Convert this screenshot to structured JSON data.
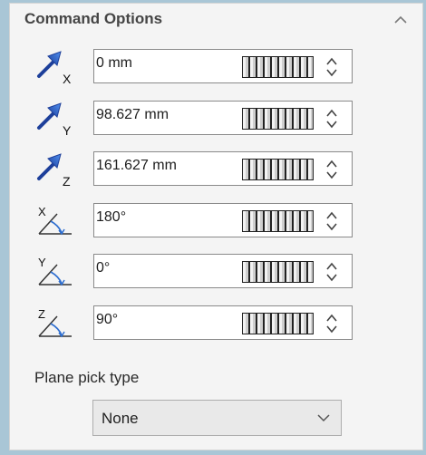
{
  "panel": {
    "title": "Command Options",
    "collapse_icon": "chevron-up-icon"
  },
  "rows": [
    {
      "icon": "translate-x-arrow-icon",
      "axis": "X",
      "value": "0 mm"
    },
    {
      "icon": "translate-y-arrow-icon",
      "axis": "Y",
      "value": "98.627 mm"
    },
    {
      "icon": "translate-z-arrow-icon",
      "axis": "Z",
      "value": "161.627 mm"
    },
    {
      "icon": "rotate-x-angle-icon",
      "axis": "X",
      "value": "180°"
    },
    {
      "icon": "rotate-y-angle-icon",
      "axis": "Y",
      "value": "0°"
    },
    {
      "icon": "rotate-z-angle-icon",
      "axis": "Z",
      "value": "90°"
    }
  ],
  "plane_pick": {
    "label": "Plane pick type",
    "selected": "None"
  },
  "colors": {
    "frame": "#a9c6d6",
    "panel_bg": "#f4f4f4",
    "arrow_blue": "#2f5fd0"
  }
}
